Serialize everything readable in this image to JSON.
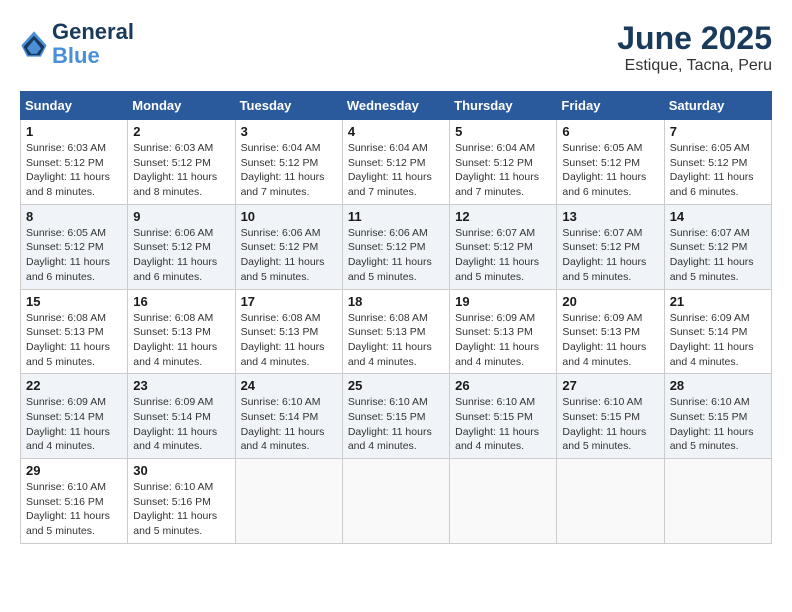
{
  "header": {
    "logo_line1": "General",
    "logo_line2": "Blue",
    "month": "June 2025",
    "location": "Estique, Tacna, Peru"
  },
  "days_of_week": [
    "Sunday",
    "Monday",
    "Tuesday",
    "Wednesday",
    "Thursday",
    "Friday",
    "Saturday"
  ],
  "weeks": [
    [
      {
        "num": "1",
        "info": "Sunrise: 6:03 AM\nSunset: 5:12 PM\nDaylight: 11 hours\nand 8 minutes."
      },
      {
        "num": "2",
        "info": "Sunrise: 6:03 AM\nSunset: 5:12 PM\nDaylight: 11 hours\nand 8 minutes."
      },
      {
        "num": "3",
        "info": "Sunrise: 6:04 AM\nSunset: 5:12 PM\nDaylight: 11 hours\nand 7 minutes."
      },
      {
        "num": "4",
        "info": "Sunrise: 6:04 AM\nSunset: 5:12 PM\nDaylight: 11 hours\nand 7 minutes."
      },
      {
        "num": "5",
        "info": "Sunrise: 6:04 AM\nSunset: 5:12 PM\nDaylight: 11 hours\nand 7 minutes."
      },
      {
        "num": "6",
        "info": "Sunrise: 6:05 AM\nSunset: 5:12 PM\nDaylight: 11 hours\nand 6 minutes."
      },
      {
        "num": "7",
        "info": "Sunrise: 6:05 AM\nSunset: 5:12 PM\nDaylight: 11 hours\nand 6 minutes."
      }
    ],
    [
      {
        "num": "8",
        "info": "Sunrise: 6:05 AM\nSunset: 5:12 PM\nDaylight: 11 hours\nand 6 minutes."
      },
      {
        "num": "9",
        "info": "Sunrise: 6:06 AM\nSunset: 5:12 PM\nDaylight: 11 hours\nand 6 minutes."
      },
      {
        "num": "10",
        "info": "Sunrise: 6:06 AM\nSunset: 5:12 PM\nDaylight: 11 hours\nand 5 minutes."
      },
      {
        "num": "11",
        "info": "Sunrise: 6:06 AM\nSunset: 5:12 PM\nDaylight: 11 hours\nand 5 minutes."
      },
      {
        "num": "12",
        "info": "Sunrise: 6:07 AM\nSunset: 5:12 PM\nDaylight: 11 hours\nand 5 minutes."
      },
      {
        "num": "13",
        "info": "Sunrise: 6:07 AM\nSunset: 5:12 PM\nDaylight: 11 hours\nand 5 minutes."
      },
      {
        "num": "14",
        "info": "Sunrise: 6:07 AM\nSunset: 5:12 PM\nDaylight: 11 hours\nand 5 minutes."
      }
    ],
    [
      {
        "num": "15",
        "info": "Sunrise: 6:08 AM\nSunset: 5:13 PM\nDaylight: 11 hours\nand 5 minutes."
      },
      {
        "num": "16",
        "info": "Sunrise: 6:08 AM\nSunset: 5:13 PM\nDaylight: 11 hours\nand 4 minutes."
      },
      {
        "num": "17",
        "info": "Sunrise: 6:08 AM\nSunset: 5:13 PM\nDaylight: 11 hours\nand 4 minutes."
      },
      {
        "num": "18",
        "info": "Sunrise: 6:08 AM\nSunset: 5:13 PM\nDaylight: 11 hours\nand 4 minutes."
      },
      {
        "num": "19",
        "info": "Sunrise: 6:09 AM\nSunset: 5:13 PM\nDaylight: 11 hours\nand 4 minutes."
      },
      {
        "num": "20",
        "info": "Sunrise: 6:09 AM\nSunset: 5:13 PM\nDaylight: 11 hours\nand 4 minutes."
      },
      {
        "num": "21",
        "info": "Sunrise: 6:09 AM\nSunset: 5:14 PM\nDaylight: 11 hours\nand 4 minutes."
      }
    ],
    [
      {
        "num": "22",
        "info": "Sunrise: 6:09 AM\nSunset: 5:14 PM\nDaylight: 11 hours\nand 4 minutes."
      },
      {
        "num": "23",
        "info": "Sunrise: 6:09 AM\nSunset: 5:14 PM\nDaylight: 11 hours\nand 4 minutes."
      },
      {
        "num": "24",
        "info": "Sunrise: 6:10 AM\nSunset: 5:14 PM\nDaylight: 11 hours\nand 4 minutes."
      },
      {
        "num": "25",
        "info": "Sunrise: 6:10 AM\nSunset: 5:15 PM\nDaylight: 11 hours\nand 4 minutes."
      },
      {
        "num": "26",
        "info": "Sunrise: 6:10 AM\nSunset: 5:15 PM\nDaylight: 11 hours\nand 4 minutes."
      },
      {
        "num": "27",
        "info": "Sunrise: 6:10 AM\nSunset: 5:15 PM\nDaylight: 11 hours\nand 5 minutes."
      },
      {
        "num": "28",
        "info": "Sunrise: 6:10 AM\nSunset: 5:15 PM\nDaylight: 11 hours\nand 5 minutes."
      }
    ],
    [
      {
        "num": "29",
        "info": "Sunrise: 6:10 AM\nSunset: 5:16 PM\nDaylight: 11 hours\nand 5 minutes."
      },
      {
        "num": "30",
        "info": "Sunrise: 6:10 AM\nSunset: 5:16 PM\nDaylight: 11 hours\nand 5 minutes."
      },
      {
        "num": "",
        "info": ""
      },
      {
        "num": "",
        "info": ""
      },
      {
        "num": "",
        "info": ""
      },
      {
        "num": "",
        "info": ""
      },
      {
        "num": "",
        "info": ""
      }
    ]
  ]
}
